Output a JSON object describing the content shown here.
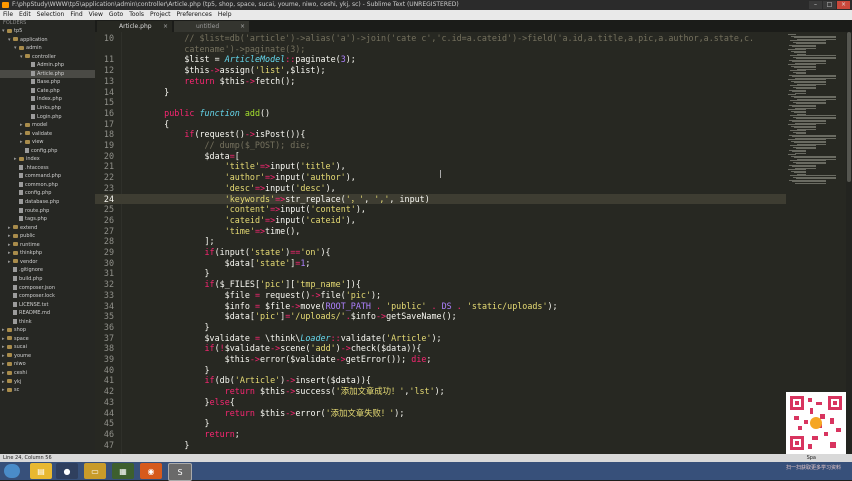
{
  "window": {
    "title": "F:\\phpStudy\\WWW\\tp5\\application\\admin\\controller\\Article.php (tp5, shop, space, sucai, youme, niwo, ceshi, ykj, sc) - Sublime Text (UNREGISTERED)"
  },
  "menu": [
    "File",
    "Edit",
    "Selection",
    "Find",
    "View",
    "Goto",
    "Tools",
    "Project",
    "Preferences",
    "Help"
  ],
  "sidebar": {
    "header": "FOLDERS",
    "items": [
      {
        "label": "tp5",
        "depth": 0,
        "type": "folder",
        "open": true
      },
      {
        "label": "application",
        "depth": 1,
        "type": "folder",
        "open": true
      },
      {
        "label": "admin",
        "depth": 2,
        "type": "folder",
        "open": true
      },
      {
        "label": "controller",
        "depth": 3,
        "type": "folder",
        "open": true
      },
      {
        "label": "Admin.php",
        "depth": 4,
        "type": "file"
      },
      {
        "label": "Article.php",
        "depth": 4,
        "type": "file",
        "selected": true
      },
      {
        "label": "Base.php",
        "depth": 4,
        "type": "file"
      },
      {
        "label": "Cate.php",
        "depth": 4,
        "type": "file"
      },
      {
        "label": "Index.php",
        "depth": 4,
        "type": "file"
      },
      {
        "label": "Links.php",
        "depth": 4,
        "type": "file"
      },
      {
        "label": "Login.php",
        "depth": 4,
        "type": "file"
      },
      {
        "label": "model",
        "depth": 3,
        "type": "folder"
      },
      {
        "label": "validate",
        "depth": 3,
        "type": "folder"
      },
      {
        "label": "view",
        "depth": 3,
        "type": "folder"
      },
      {
        "label": "config.php",
        "depth": 3,
        "type": "file"
      },
      {
        "label": "index",
        "depth": 2,
        "type": "folder"
      },
      {
        "label": ".htaccess",
        "depth": 2,
        "type": "file"
      },
      {
        "label": "command.php",
        "depth": 2,
        "type": "file"
      },
      {
        "label": "common.php",
        "depth": 2,
        "type": "file"
      },
      {
        "label": "config.php",
        "depth": 2,
        "type": "file"
      },
      {
        "label": "database.php",
        "depth": 2,
        "type": "file"
      },
      {
        "label": "route.php",
        "depth": 2,
        "type": "file"
      },
      {
        "label": "tags.php",
        "depth": 2,
        "type": "file"
      },
      {
        "label": "extend",
        "depth": 1,
        "type": "folder"
      },
      {
        "label": "public",
        "depth": 1,
        "type": "folder"
      },
      {
        "label": "runtime",
        "depth": 1,
        "type": "folder"
      },
      {
        "label": "thinkphp",
        "depth": 1,
        "type": "folder"
      },
      {
        "label": "vendor",
        "depth": 1,
        "type": "folder"
      },
      {
        "label": ".gitignore",
        "depth": 1,
        "type": "file"
      },
      {
        "label": "build.php",
        "depth": 1,
        "type": "file"
      },
      {
        "label": "composer.json",
        "depth": 1,
        "type": "file"
      },
      {
        "label": "composer.lock",
        "depth": 1,
        "type": "file"
      },
      {
        "label": "LICENSE.txt",
        "depth": 1,
        "type": "file"
      },
      {
        "label": "README.md",
        "depth": 1,
        "type": "file"
      },
      {
        "label": "think",
        "depth": 1,
        "type": "file"
      },
      {
        "label": "shop",
        "depth": 0,
        "type": "folder"
      },
      {
        "label": "space",
        "depth": 0,
        "type": "folder"
      },
      {
        "label": "sucai",
        "depth": 0,
        "type": "folder"
      },
      {
        "label": "youme",
        "depth": 0,
        "type": "folder"
      },
      {
        "label": "niwo",
        "depth": 0,
        "type": "folder"
      },
      {
        "label": "ceshi",
        "depth": 0,
        "type": "folder"
      },
      {
        "label": "ykj",
        "depth": 0,
        "type": "folder"
      },
      {
        "label": "sc",
        "depth": 0,
        "type": "folder"
      }
    ]
  },
  "tabs": [
    {
      "label": "Article.php",
      "active": true
    },
    {
      "label": "untitled",
      "active": false
    }
  ],
  "tab_close_glyph": "×",
  "code": {
    "current_line": 24,
    "lines": [
      {
        "n": "10",
        "t": [
          [
            "c",
            "        // $list=db('article')->alias('a')->join('cate c','c.id=a.cateid')->field('a.id,a.title,a.pic,a.author,a.state,c."
          ]
        ]
      },
      {
        "n": "",
        "t": [
          [
            "c",
            "        catename')->paginate(3);"
          ]
        ]
      },
      {
        "n": "11",
        "t": [
          [
            "",
            "        $list = "
          ],
          [
            "i",
            "ArticleModel"
          ],
          [
            "k",
            "::"
          ],
          [
            "",
            "paginate("
          ],
          [
            "n",
            "3"
          ],
          [
            "",
            ");"
          ]
        ]
      },
      {
        "n": "12",
        "t": [
          [
            "",
            "        $this"
          ],
          [
            "k",
            "->"
          ],
          [
            "",
            "assign("
          ],
          [
            "s",
            "'list'"
          ],
          [
            "",
            ",$list);"
          ]
        ]
      },
      {
        "n": "13",
        "t": [
          [
            "",
            "        "
          ],
          [
            "k",
            "return"
          ],
          [
            "",
            " $this"
          ],
          [
            "k",
            "->"
          ],
          [
            "",
            "fetch();"
          ]
        ]
      },
      {
        "n": "14",
        "t": [
          [
            "",
            "    }"
          ]
        ]
      },
      {
        "n": "15",
        "t": [
          [
            "",
            ""
          ]
        ]
      },
      {
        "n": "16",
        "t": [
          [
            "",
            "    "
          ],
          [
            "k",
            "public"
          ],
          [
            "",
            " "
          ],
          [
            "i",
            "function"
          ],
          [
            "",
            " "
          ],
          [
            "g",
            "add"
          ],
          [
            "",
            "()"
          ]
        ]
      },
      {
        "n": "17",
        "t": [
          [
            "",
            "    {"
          ]
        ]
      },
      {
        "n": "18",
        "t": [
          [
            "",
            "        "
          ],
          [
            "k",
            "if"
          ],
          [
            "",
            "(request()"
          ],
          [
            "k",
            "->"
          ],
          [
            "",
            "isPost()){"
          ]
        ]
      },
      {
        "n": "19",
        "t": [
          [
            "c",
            "            // dump($_POST); die;"
          ]
        ]
      },
      {
        "n": "20",
        "t": [
          [
            "",
            "            $data"
          ],
          [
            "k",
            "="
          ],
          [
            "",
            "["
          ]
        ]
      },
      {
        "n": "21",
        "t": [
          [
            "",
            "                "
          ],
          [
            "s",
            "'title'"
          ],
          [
            "k",
            "=>"
          ],
          [
            "",
            "input("
          ],
          [
            "s",
            "'title'"
          ],
          [
            "",
            "),"
          ]
        ]
      },
      {
        "n": "22",
        "t": [
          [
            "",
            "                "
          ],
          [
            "s",
            "'author'"
          ],
          [
            "k",
            "=>"
          ],
          [
            "",
            "input("
          ],
          [
            "s",
            "'author'"
          ],
          [
            "",
            "),"
          ]
        ]
      },
      {
        "n": "23",
        "t": [
          [
            "",
            "                "
          ],
          [
            "s",
            "'desc'"
          ],
          [
            "k",
            "=>"
          ],
          [
            "",
            "input("
          ],
          [
            "s",
            "'desc'"
          ],
          [
            "",
            "),"
          ]
        ]
      },
      {
        "n": "24",
        "t": [
          [
            "",
            "                "
          ],
          [
            "s",
            "'keywords'"
          ],
          [
            "k",
            "=>"
          ],
          [
            "",
            "str_replace("
          ],
          [
            "s",
            "'，'"
          ],
          [
            "",
            ", "
          ],
          [
            "s",
            "','"
          ],
          [
            "",
            ", input)"
          ]
        ]
      },
      {
        "n": "25",
        "t": [
          [
            "",
            "                "
          ],
          [
            "s",
            "'content'"
          ],
          [
            "k",
            "=>"
          ],
          [
            "",
            "input("
          ],
          [
            "s",
            "'content'"
          ],
          [
            "",
            "),"
          ]
        ]
      },
      {
        "n": "26",
        "t": [
          [
            "",
            "                "
          ],
          [
            "s",
            "'cateid'"
          ],
          [
            "k",
            "=>"
          ],
          [
            "",
            "input("
          ],
          [
            "s",
            "'cateid'"
          ],
          [
            "",
            "),"
          ]
        ]
      },
      {
        "n": "27",
        "t": [
          [
            "",
            "                "
          ],
          [
            "s",
            "'time'"
          ],
          [
            "k",
            "=>"
          ],
          [
            "",
            "time(),"
          ]
        ]
      },
      {
        "n": "28",
        "t": [
          [
            "",
            "            ];"
          ]
        ]
      },
      {
        "n": "29",
        "t": [
          [
            "",
            "            "
          ],
          [
            "k",
            "if"
          ],
          [
            "",
            "(input("
          ],
          [
            "s",
            "'state'"
          ],
          [
            "",
            ")"
          ],
          [
            "k",
            "=="
          ],
          [
            "s",
            "'on'"
          ],
          [
            "",
            "){"
          ]
        ]
      },
      {
        "n": "30",
        "t": [
          [
            "",
            "                $data["
          ],
          [
            "s",
            "'state'"
          ],
          [
            "",
            "]"
          ],
          [
            "k",
            "="
          ],
          [
            "n",
            "1"
          ],
          [
            "",
            ";"
          ]
        ]
      },
      {
        "n": "31",
        "t": [
          [
            "",
            "            }"
          ]
        ]
      },
      {
        "n": "32",
        "t": [
          [
            "",
            "            "
          ],
          [
            "k",
            "if"
          ],
          [
            "",
            "($_FILES["
          ],
          [
            "s",
            "'pic'"
          ],
          [
            "",
            "]["
          ],
          [
            "s",
            "'tmp_name'"
          ],
          [
            "",
            "]){"
          ]
        ]
      },
      {
        "n": "33",
        "t": [
          [
            "",
            "                $file "
          ],
          [
            "k",
            "="
          ],
          [
            "",
            " request()"
          ],
          [
            "k",
            "->"
          ],
          [
            "",
            "file("
          ],
          [
            "s",
            "'pic'"
          ],
          [
            "",
            ");"
          ]
        ]
      },
      {
        "n": "34",
        "t": [
          [
            "",
            "                $info "
          ],
          [
            "k",
            "="
          ],
          [
            "",
            " $file"
          ],
          [
            "k",
            "->"
          ],
          [
            "",
            "move("
          ],
          [
            "n",
            "ROOT_PATH"
          ],
          [
            "k",
            " . "
          ],
          [
            "s",
            "'public'"
          ],
          [
            "k",
            " . "
          ],
          [
            "n",
            "DS"
          ],
          [
            "k",
            " . "
          ],
          [
            "s",
            "'static/uploads'"
          ],
          [
            "",
            ");"
          ]
        ]
      },
      {
        "n": "35",
        "t": [
          [
            "",
            "                $data["
          ],
          [
            "s",
            "'pic'"
          ],
          [
            "",
            "]"
          ],
          [
            "k",
            "="
          ],
          [
            "s",
            "'/uploads/'"
          ],
          [
            "k",
            "."
          ],
          [
            "",
            "$info"
          ],
          [
            "k",
            "->"
          ],
          [
            "",
            "getSaveName();"
          ]
        ]
      },
      {
        "n": "36",
        "t": [
          [
            "",
            "            }"
          ]
        ]
      },
      {
        "n": "37",
        "t": [
          [
            "",
            "            $validate "
          ],
          [
            "k",
            "="
          ],
          [
            "",
            " \\think\\"
          ],
          [
            "i",
            "Loader"
          ],
          [
            "k",
            "::"
          ],
          [
            "",
            "validate("
          ],
          [
            "s",
            "'Article'"
          ],
          [
            "",
            ");"
          ]
        ]
      },
      {
        "n": "38",
        "t": [
          [
            "",
            "            "
          ],
          [
            "k",
            "if"
          ],
          [
            "",
            "("
          ],
          [
            "k",
            "!"
          ],
          [
            "",
            "$validate"
          ],
          [
            "k",
            "->"
          ],
          [
            "",
            "scene("
          ],
          [
            "s",
            "'add'"
          ],
          [
            "",
            ")"
          ],
          [
            "k",
            "->"
          ],
          [
            "",
            "check($data)){"
          ]
        ]
      },
      {
        "n": "39",
        "t": [
          [
            "",
            "                $this"
          ],
          [
            "k",
            "->"
          ],
          [
            "",
            "error($validate"
          ],
          [
            "k",
            "->"
          ],
          [
            "",
            "getError()); "
          ],
          [
            "k",
            "die"
          ],
          [
            "",
            ";"
          ]
        ]
      },
      {
        "n": "40",
        "t": [
          [
            "",
            "            }"
          ]
        ]
      },
      {
        "n": "41",
        "t": [
          [
            "",
            "            "
          ],
          [
            "k",
            "if"
          ],
          [
            "",
            "(db("
          ],
          [
            "s",
            "'Article'"
          ],
          [
            "",
            ")"
          ],
          [
            "k",
            "->"
          ],
          [
            "",
            "insert($data)){"
          ]
        ]
      },
      {
        "n": "42",
        "t": [
          [
            "",
            "                "
          ],
          [
            "k",
            "return"
          ],
          [
            "",
            " $this"
          ],
          [
            "k",
            "->"
          ],
          [
            "",
            "success("
          ],
          [
            "s",
            "'添加文章成功！'"
          ],
          [
            "",
            ","
          ],
          [
            "s",
            "'lst'"
          ],
          [
            "",
            ");"
          ]
        ]
      },
      {
        "n": "43",
        "t": [
          [
            "",
            "            }"
          ],
          [
            "k",
            "else"
          ],
          [
            "",
            "{"
          ]
        ]
      },
      {
        "n": "44",
        "t": [
          [
            "",
            "                "
          ],
          [
            "k",
            "return"
          ],
          [
            "",
            " $this"
          ],
          [
            "k",
            "->"
          ],
          [
            "",
            "error("
          ],
          [
            "s",
            "'添加文章失败！'"
          ],
          [
            "",
            ");"
          ]
        ]
      },
      {
        "n": "45",
        "t": [
          [
            "",
            "            }"
          ]
        ]
      },
      {
        "n": "46",
        "t": [
          [
            "",
            "            "
          ],
          [
            "k",
            "return"
          ],
          [
            "",
            ";"
          ]
        ]
      },
      {
        "n": "47",
        "t": [
          [
            "",
            "        }"
          ]
        ]
      }
    ]
  },
  "status": {
    "left": "Line 24, Column 56",
    "right": "Spa"
  },
  "qr": {
    "caption": "扫一扫获取更多学习资料"
  },
  "colors": {
    "accent": "#f92672",
    "string": "#e6db74",
    "comment": "#75715e",
    "builtin": "#66d9ef"
  }
}
